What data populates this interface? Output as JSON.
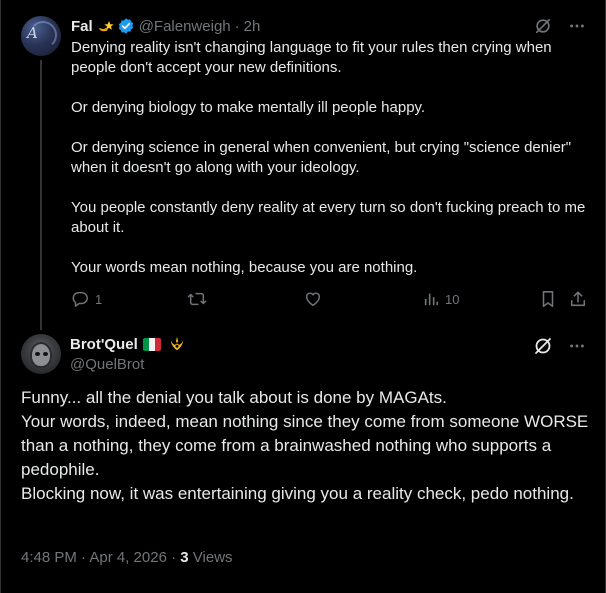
{
  "colors": {
    "background": "#000000",
    "text": "#e7e9ea",
    "muted": "#71767b",
    "verified": "#1d9bf0",
    "divider": "#2f3336"
  },
  "reply_tweet": {
    "display_name": "Fal",
    "handle": "@Falenweigh",
    "separator": "·",
    "time": "2h",
    "badge_icon": "shooting-star-emoji",
    "verified_icon": "verified-badge-icon",
    "paragraphs": [
      "Denying reality isn't changing language to fit your rules then crying when people don't accept your new definitions.",
      "Or denying biology to make mentally ill people happy.",
      "Or denying science in general when convenient, but crying \"science denier\" when it doesn't go along with your ideology.",
      "You people constantly deny reality at every turn so don't fucking preach to me about it.",
      "Your words mean nothing, because you are nothing."
    ],
    "actions": {
      "reply_count": "1",
      "retweet_count": "",
      "like_count": "",
      "views_count": "10"
    }
  },
  "main_tweet": {
    "display_name": "Brot'Quel",
    "handle": "@QuelBrot",
    "flag_icon": "italy-flag-emoji",
    "org_icon": "rebel-alliance-emoji",
    "text": "Funny... all the denial you talk about is done by MAGAts.\nYour words, indeed, mean nothing since they come from someone WORSE than a nothing, they come from a brainwashed nothing who supports a pedophile.\nBlocking now, it was entertaining giving you a reality check, pedo nothing.",
    "timestamp": "4:48 PM · Apr 4, 2026",
    "separator": "·",
    "views_count": "3",
    "views_label": "Views"
  }
}
